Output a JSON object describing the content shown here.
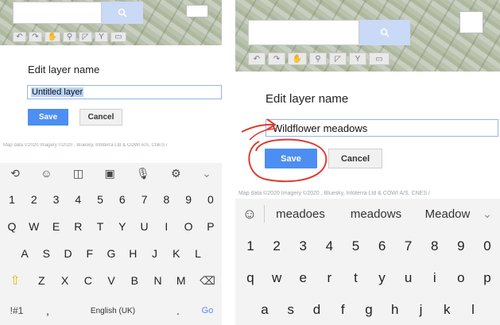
{
  "left": {
    "map_search_icon": "search-icon",
    "dialog_title": "Edit layer name",
    "input_value": "Untitled layer",
    "save_label": "Save",
    "cancel_label": "Cancel",
    "attribution": "Map data ©2020 Imagery ©2020 , Bluesky, Infoterra Ltd & COWI A/S, CNES /",
    "keyboard": {
      "toolbar_icons": [
        "translate-icon",
        "emoji-icon",
        "sticker-icon",
        "gif-icon",
        "microphone-icon",
        "settings-icon",
        "chevron-down-icon"
      ],
      "row1": [
        "1",
        "2",
        "3",
        "4",
        "5",
        "6",
        "7",
        "8",
        "9",
        "0"
      ],
      "row2": [
        "Q",
        "W",
        "E",
        "R",
        "T",
        "Y",
        "U",
        "I",
        "O",
        "P"
      ],
      "row3": [
        "A",
        "S",
        "D",
        "F",
        "G",
        "H",
        "J",
        "K",
        "L"
      ],
      "row4": [
        "Z",
        "X",
        "C",
        "V",
        "B",
        "N",
        "M"
      ],
      "shift": "⇧",
      "backspace": "⌫",
      "symbols": "!#1",
      "comma": ",",
      "space": "English (UK)",
      "period": ".",
      "go": "Go"
    }
  },
  "right": {
    "dialog_title": "Edit layer name",
    "input_value": "Wildflower meadows",
    "save_label": "Save",
    "cancel_label": "Cancel",
    "attribution": "Map data ©2020 Imagery ©2020 , Bluesky, Infoterra Ltd & COWI A/S, CNES /",
    "keyboard": {
      "suggestions": [
        "meadoes",
        "meadows",
        "Meadow"
      ],
      "row1": [
        "1",
        "2",
        "3",
        "4",
        "5",
        "6",
        "7",
        "8",
        "9",
        "0"
      ],
      "row2": [
        "q",
        "w",
        "e",
        "r",
        "t",
        "y",
        "u",
        "i",
        "o",
        "p"
      ],
      "row3": [
        "a",
        "s",
        "d",
        "f",
        "g",
        "h",
        "j",
        "k",
        "l"
      ]
    }
  },
  "colors": {
    "save_blue": "#4d8ef3",
    "annotation_red": "#e03a2f",
    "selection_blue": "#b9d3f7",
    "shift_yellow": "#e6b800"
  }
}
